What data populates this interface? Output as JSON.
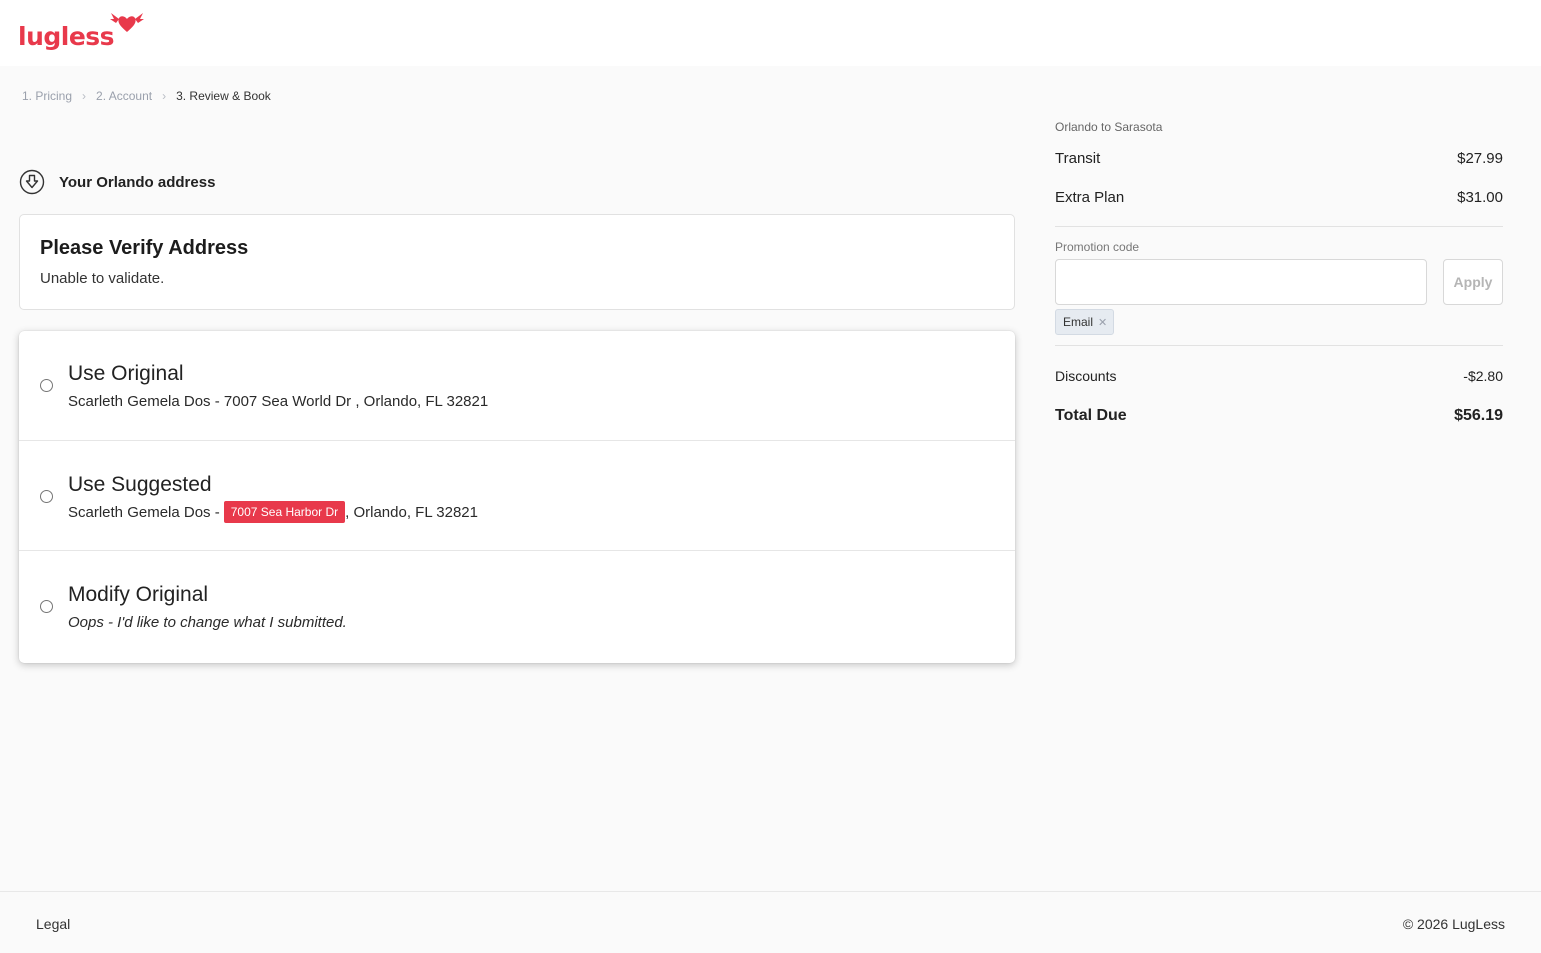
{
  "brand": {
    "logo_text": "lugless",
    "accent_color": "#e8394b"
  },
  "breadcrumb": {
    "steps": [
      {
        "label": "1. Pricing",
        "active": false
      },
      {
        "label": "2. Account",
        "active": false
      },
      {
        "label": "3. Review & Book",
        "active": true
      }
    ],
    "separator_icon": "chevron-right-icon"
  },
  "address_section": {
    "icon": "arrow-down-circle-icon",
    "title": "Your Orlando address"
  },
  "verify": {
    "title": "Please Verify Address",
    "subtitle": "Unable to validate."
  },
  "options": [
    {
      "title": "Use Original",
      "prefix": "Scarleth Gemela Dos - 7007 Sea World Dr , Orlando, FL 32821"
    },
    {
      "title": "Use Suggested",
      "prefix": "Scarleth Gemela Dos - ",
      "highlight": "7007 Sea Harbor Dr",
      "suffix": ", Orlando, FL 32821"
    },
    {
      "title": "Modify Original",
      "prefix": "Oops - I'd like to change what I submitted."
    }
  ],
  "summary": {
    "route": "Orlando to Sarasota",
    "items": [
      {
        "label": "Transit",
        "amount": "$27.99"
      },
      {
        "label": "Extra Plan",
        "amount": "$31.00"
      }
    ],
    "promo": {
      "label": "Promotion code",
      "value": "",
      "placeholder": "",
      "apply_label": "Apply",
      "tag_label": "Email",
      "tag_remove_icon": "close-icon"
    },
    "discounts": {
      "label": "Discounts",
      "amount": "-$2.80"
    },
    "total": {
      "label": "Total Due",
      "amount": "$56.19"
    }
  },
  "footer": {
    "legal": "Legal",
    "copyright": "© 2026 LugLess"
  }
}
